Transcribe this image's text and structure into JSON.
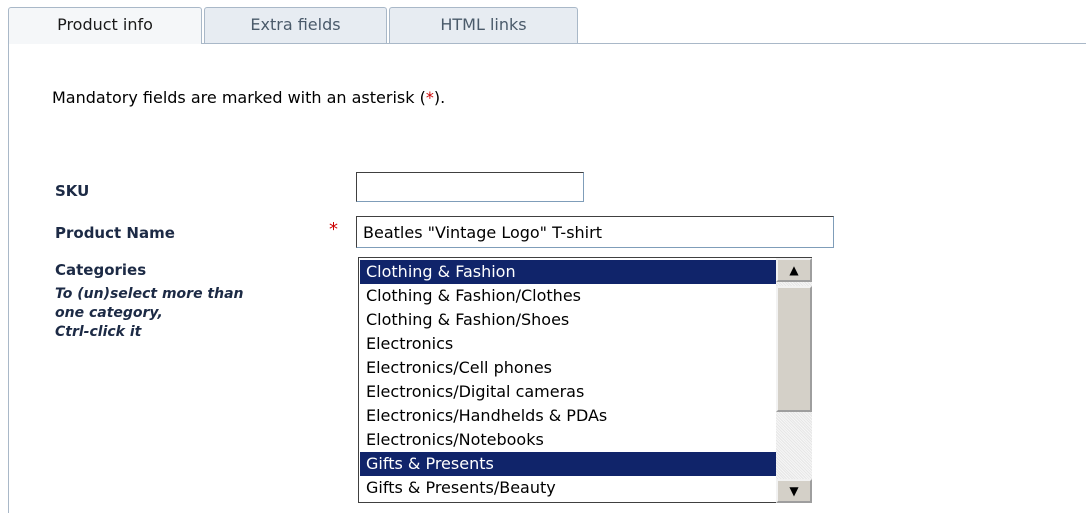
{
  "tabs": [
    {
      "label": "Product info",
      "active": true
    },
    {
      "label": "Extra fields",
      "active": false
    },
    {
      "label": "HTML links",
      "active": false
    }
  ],
  "note": {
    "prefix": "Mandatory fields are marked with an asterisk (",
    "asterisk": "*",
    "suffix": ")."
  },
  "form": {
    "sku_label": "SKU",
    "sku_value": "",
    "name_label": "Product Name",
    "name_required_mark": "*",
    "name_value": "Beatles \"Vintage Logo\" T-shirt",
    "categories_label": "Categories",
    "categories_hint_1": "To (un)select more than",
    "categories_hint_2": "one category,",
    "categories_hint_3": "Ctrl-click it"
  },
  "categories": [
    {
      "label": "Clothing & Fashion",
      "selected": true
    },
    {
      "label": "Clothing & Fashion/Clothes",
      "selected": false
    },
    {
      "label": "Clothing & Fashion/Shoes",
      "selected": false
    },
    {
      "label": "Electronics",
      "selected": false
    },
    {
      "label": "Electronics/Cell phones",
      "selected": false
    },
    {
      "label": "Electronics/Digital cameras",
      "selected": false
    },
    {
      "label": "Electronics/Handhelds & PDAs",
      "selected": false
    },
    {
      "label": "Electronics/Notebooks",
      "selected": false
    },
    {
      "label": "Gifts & Presents",
      "selected": true
    },
    {
      "label": "Gifts & Presents/Beauty",
      "selected": false
    }
  ],
  "colors": {
    "selection": "#10246a",
    "required": "#cc0000",
    "label": "#1c2a45"
  },
  "icons": {
    "scroll_up": "triangle-up-icon",
    "scroll_down": "triangle-down-icon"
  }
}
